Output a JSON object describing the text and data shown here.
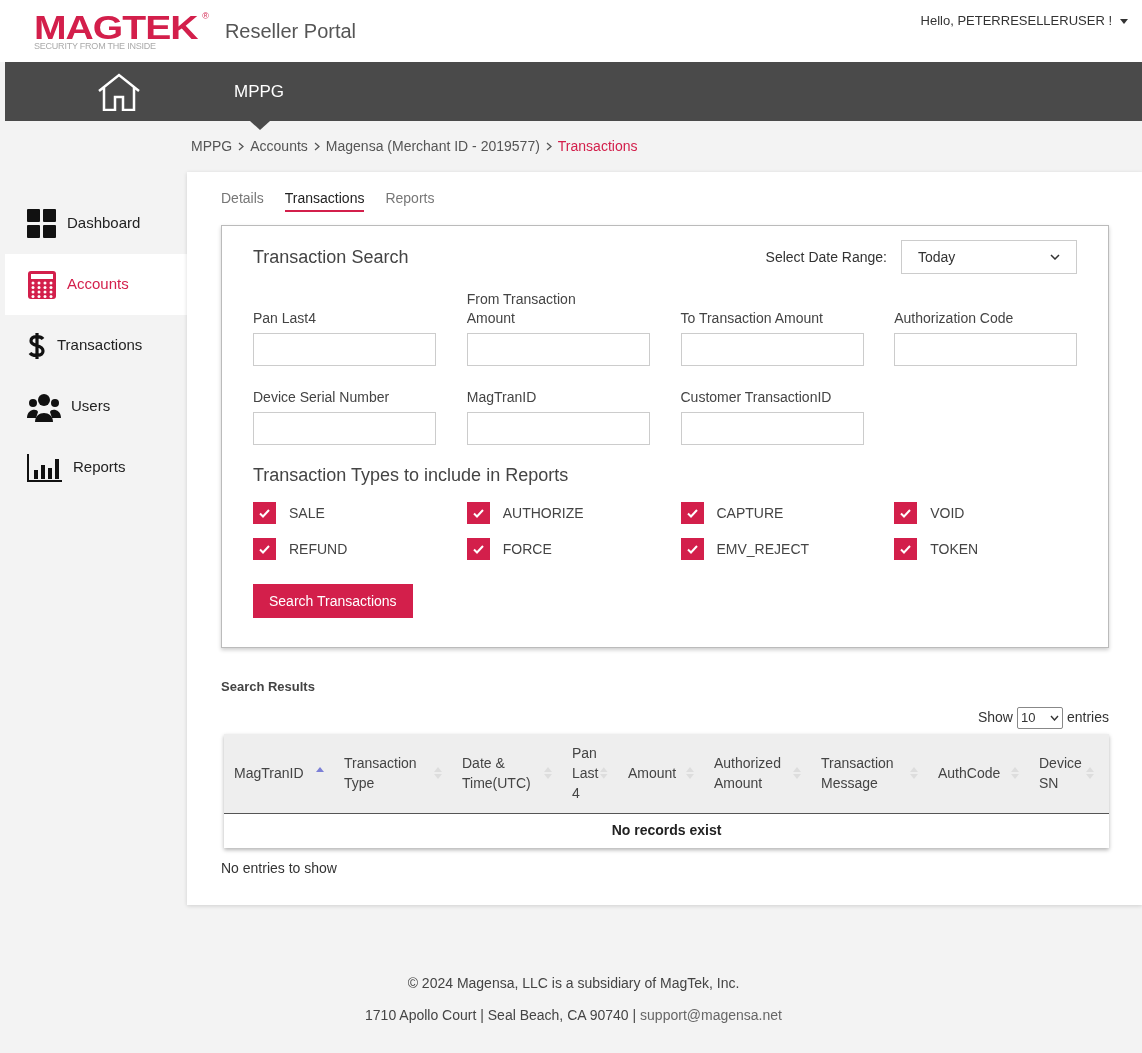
{
  "header": {
    "logo": {
      "wordmark": "MAGTEK",
      "registered": "®",
      "tagline": "SECURITY FROM THE INSIDE"
    },
    "portal_title": "Reseller Portal",
    "user_menu": "Hello, PETERRESELLERUSER !"
  },
  "navbar": {
    "items": [
      {
        "label": "MPPG",
        "selected": true
      }
    ]
  },
  "breadcrumb": [
    {
      "label": "MPPG",
      "current": false
    },
    {
      "label": "Accounts",
      "current": false
    },
    {
      "label": "Magensa (Merchant ID - 2019577)",
      "current": false
    },
    {
      "label": "Transactions",
      "current": true
    }
  ],
  "sidebar": {
    "items": [
      {
        "kind": "dashboard",
        "label": "Dashboard",
        "selected": false
      },
      {
        "kind": "accounts",
        "label": "Accounts",
        "selected": true
      },
      {
        "kind": "transactions",
        "label": "Transactions",
        "selected": false
      },
      {
        "kind": "users",
        "label": "Users",
        "selected": false
      },
      {
        "kind": "reports",
        "label": "Reports",
        "selected": false
      }
    ]
  },
  "tabs": [
    {
      "label": "Details",
      "selected": false
    },
    {
      "label": "Transactions",
      "selected": true
    },
    {
      "label": "Reports",
      "selected": false
    }
  ],
  "search": {
    "title": "Transaction Search",
    "date_range_label": "Select Date Range:",
    "date_range_value": "Today",
    "fields": [
      {
        "label": "Pan Last4"
      },
      {
        "label": "From Transaction Amount"
      },
      {
        "label": "To Transaction Amount"
      },
      {
        "label": "Authorization Code"
      },
      {
        "label": "Device Serial Number"
      },
      {
        "label": "MagTranID"
      },
      {
        "label": "Customer TransactionID"
      }
    ],
    "types_title": "Transaction Types to include in Reports",
    "types": [
      {
        "label": "SALE",
        "checked": true
      },
      {
        "label": "AUTHORIZE",
        "checked": true
      },
      {
        "label": "CAPTURE",
        "checked": true
      },
      {
        "label": "VOID",
        "checked": true
      },
      {
        "label": "REFUND",
        "checked": true
      },
      {
        "label": "FORCE",
        "checked": true
      },
      {
        "label": "EMV_REJECT",
        "checked": true
      },
      {
        "label": "TOKEN",
        "checked": true
      }
    ],
    "button": "Search Transactions"
  },
  "results": {
    "title": "Search Results",
    "show_label": "Show",
    "page_size": "10",
    "entries_label": "entries",
    "columns": [
      {
        "label": "MagTranID",
        "sorted": true
      },
      {
        "label": "Transaction Type",
        "sorted": false
      },
      {
        "label": "Date & Time(UTC)",
        "sorted": false
      },
      {
        "label": "Pan Last 4",
        "sorted": false
      },
      {
        "label": "Amount",
        "sorted": false
      },
      {
        "label": "Authorized Amount",
        "sorted": false
      },
      {
        "label": "Transaction Message",
        "sorted": false
      },
      {
        "label": "AuthCode",
        "sorted": false
      },
      {
        "label": "Device SN",
        "sorted": false
      }
    ],
    "empty_message": "No records exist",
    "info": "No entries to show"
  },
  "footer": {
    "line_1": "© 2024 Magensa, LLC is a subsidiary of MagTek, Inc.",
    "line_2": "1710 Apollo Court | Seal Beach, CA 90740 | ",
    "email": "support@magensa.net"
  }
}
